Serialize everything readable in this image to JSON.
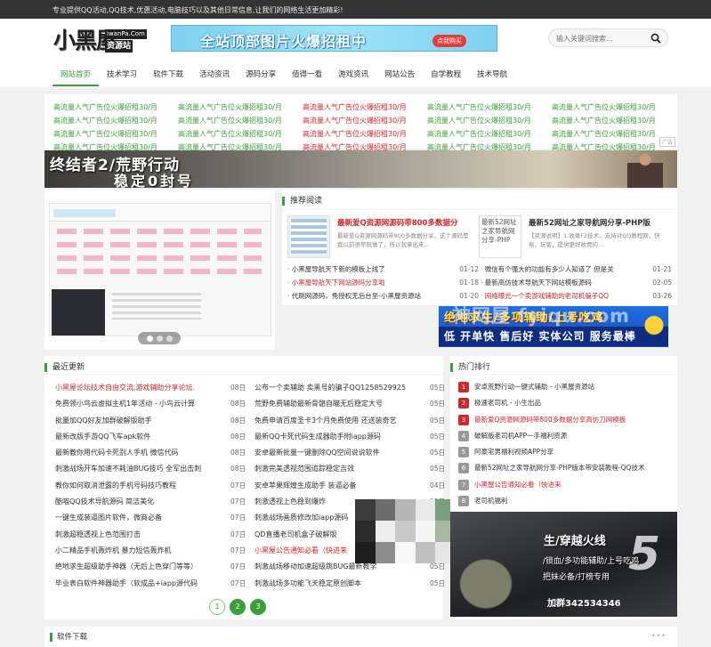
{
  "topbar": {
    "text": "专业提供QQ活动,QQ技术,优惠活动,电脑技巧以及其他日常信息,让我们的网络生活更加精彩!"
  },
  "logo": {
    "big": "小黑屋",
    "small": "iwanPa.Com",
    "sub": "资源站"
  },
  "header_banner": {
    "text": "全站顶部图片火爆招租中",
    "button": "点我购买"
  },
  "search": {
    "placeholder": "输入关键词搜索..."
  },
  "nav": [
    {
      "label": "网站首页"
    },
    {
      "label": "技术学习"
    },
    {
      "label": "软件下载"
    },
    {
      "label": "活动资讯"
    },
    {
      "label": "源码分享"
    },
    {
      "label": "值得一看"
    },
    {
      "label": "游戏资讯"
    },
    {
      "label": "网站公告"
    },
    {
      "label": "自学教程"
    },
    {
      "label": "技术导航"
    }
  ],
  "ads": {
    "text": "高流量人气广告位火爆招租30/月",
    "colors": [
      "#3a9f3a",
      "#3a9f3a",
      "#d0282a",
      "#3a9f3a",
      "#3a9f3a"
    ],
    "tag": "广告"
  },
  "wide_banner": {
    "line1": "终结者2/荒野行动",
    "line2": "稳定0封号"
  },
  "recommend": {
    "title": "推荐阅读",
    "featured": [
      {
        "title": "最新爱Q资源网源码带800多数据分",
        "desc": "最新爱Q资源网源码带800多数据分享，这个源码是我以前很早就做了，所以就拿出来...",
        "red": true,
        "thumb_alt": ""
      },
      {
        "title": "最新52网址之家导航网分享-PHP版",
        "desc": "【资源说明】1.收录F2技术，支持对QQ教程网，快易，玩客，提供更好收费的...",
        "red": false,
        "thumb_alt": "最新52网址之家导航网分享-PHP"
      }
    ],
    "list_left": [
      {
        "text": "· 小黑屋导航天下新的模板上线了",
        "date": "01-12",
        "color": "#333"
      },
      {
        "text": "· 小黑屋导航天下网站源码分享啦",
        "date": "01-18",
        "color": "#d0282a"
      },
      {
        "text": "· 代刷网源码，免授权无后台至-小黑屋资源站",
        "date": "01-20",
        "color": "#333"
      }
    ],
    "list_right": [
      {
        "text": "· 微信有个强大的功能有多少人知道了 但是关",
        "date": "01-21",
        "color": "#333"
      },
      {
        "text": "· 最新高仿技术导航天下网站模板源码",
        "date": "02-05",
        "color": "#333"
      },
      {
        "text": "· 网络曝光一个卖游戏辅助的老司机骗子QQ",
        "date": "03-26",
        "color": "#d0282a"
      }
    ]
  },
  "banner2": {
    "line1": "绝地求生/多项辅助/上号吃鸡",
    "line2": "低 开单快 售后好 实体公司 服务最棒"
  },
  "watermark": "神网屋 fyiqu.com",
  "latest": {
    "title": "最近更新",
    "left": [
      {
        "text": "小黑屋论坛技术自由交流,游戏辅助分享论坛.",
        "date": "08日",
        "color": "#d0282a"
      },
      {
        "text": "免费领小鸟云虚拟主机1年活动 - 小鸟云计算",
        "date": "08日",
        "color": "#333"
      },
      {
        "text": "批量加QQ好友加群破解版助手",
        "date": "08日",
        "color": "#333"
      },
      {
        "text": "最新改版手游QQ飞车apk软件",
        "date": "08日",
        "color": "#333"
      },
      {
        "text": "最新教你用代码卡死别人手机 微信代码",
        "date": "08日",
        "color": "#333"
      },
      {
        "text": "刺激战场开车加速不耗油BUG技巧 全军出击刺",
        "date": "08日",
        "color": "#333"
      },
      {
        "text": "教你如何取消泄露的手机号码技巧教程",
        "date": "07日",
        "color": "#333"
      },
      {
        "text": "酷喵QQ技术导航源码 简洁美化",
        "date": "07日",
        "color": "#333"
      },
      {
        "text": "一键生成装逼图片软件，微商必备",
        "date": "07日",
        "color": "#333"
      },
      {
        "text": "刺激超稳透视上色范围打击",
        "date": "07日",
        "color": "#333"
      },
      {
        "text": "小二精品手机轰炸机 暴力短信轰炸机",
        "date": "07日",
        "color": "#333"
      },
      {
        "text": "绝地求生超级助手神器（无后上色穿门等等）",
        "date": "07日",
        "color": "#333"
      },
      {
        "text": "毕业表白软件神器助手（软成品+iapp源代码",
        "date": "07日",
        "color": "#333"
      }
    ],
    "right": [
      {
        "text": "公布一个卖辅助 卖黑号的骗子QQ1258529925",
        "date": "05日",
        "color": "#333"
      },
      {
        "text": "荒野免费辅助最新骨骼自瞄无后稳定大号",
        "date": "05日",
        "color": "#333"
      },
      {
        "text": "免费申请百度圣卡3个月免费使用 还送装奇艺",
        "date": "05日",
        "color": "#333"
      },
      {
        "text": "最新QQ卡死代码生成器助手附iapp源码",
        "date": "05日",
        "color": "#333"
      },
      {
        "text": "安卓最新批量一键删除QQ空间说说软件",
        "date": "05日",
        "color": "#333"
      },
      {
        "text": "刺激完美透视范围追踪稳定吉效",
        "date": "05日",
        "color": "#333"
      },
      {
        "text": "安卓苹果辉煌生成助手 装逼必备",
        "date": "04日",
        "color": "#333"
      },
      {
        "text": "刺激透视上色稳到爆炸",
        "date": "05日",
        "color": "#333"
      },
      {
        "text": "刺激战场画质修改加iapp源码",
        "date": "05日",
        "color": "#333"
      },
      {
        "text": "QD直播老司机盒子破解版",
        "date": "05日",
        "color": "#333"
      },
      {
        "text": "小黑屋公告通知必看（快进来",
        "date": "05日",
        "color": "#d0282a"
      },
      {
        "text": "刺激战场移动加速超级跳BUG最新教学",
        "date": "05日",
        "color": "#333"
      },
      {
        "text": "刺激战场多功能飞天稳定原创脚本",
        "date": "05日",
        "color": "#333"
      }
    ],
    "pages": [
      "1",
      "2",
      "3"
    ]
  },
  "hot": {
    "title": "热门排行",
    "items": [
      {
        "num": "1",
        "text": "安卓荒野行动一键式辅助 - 小黑屋资源站",
        "color": "#333"
      },
      {
        "num": "2",
        "text": "极速老司机 - 小生出品",
        "color": "#333"
      },
      {
        "num": "3",
        "text": "最新爱Q资源网源码带800多数据分享高仿刀网模板",
        "color": "#d0282a"
      },
      {
        "num": "4",
        "text": "破解版老司机APP一手福利资源",
        "color": "#333"
      },
      {
        "num": "5",
        "text": "阿豪宅男福利视频APP分享",
        "color": "#333"
      },
      {
        "num": "6",
        "text": "最新52网址之家导航网分享-PHP版本带安装教程-QQ技术",
        "color": "#333"
      },
      {
        "num": "7",
        "text": "小黑屋公告通知必看（快进来",
        "color": "#d0282a"
      },
      {
        "num": "8",
        "text": "老司机福利",
        "color": "#333"
      }
    ],
    "game_ad": {
      "line1": "生/穿越火线",
      "line2": "/锁血/多功能辅助/上号吃鸡",
      "line3": "把妹必备/打榜专用",
      "line4": "加群342534346",
      "big": "5"
    }
  },
  "software": {
    "title": "软件下载",
    "more": "•••"
  }
}
